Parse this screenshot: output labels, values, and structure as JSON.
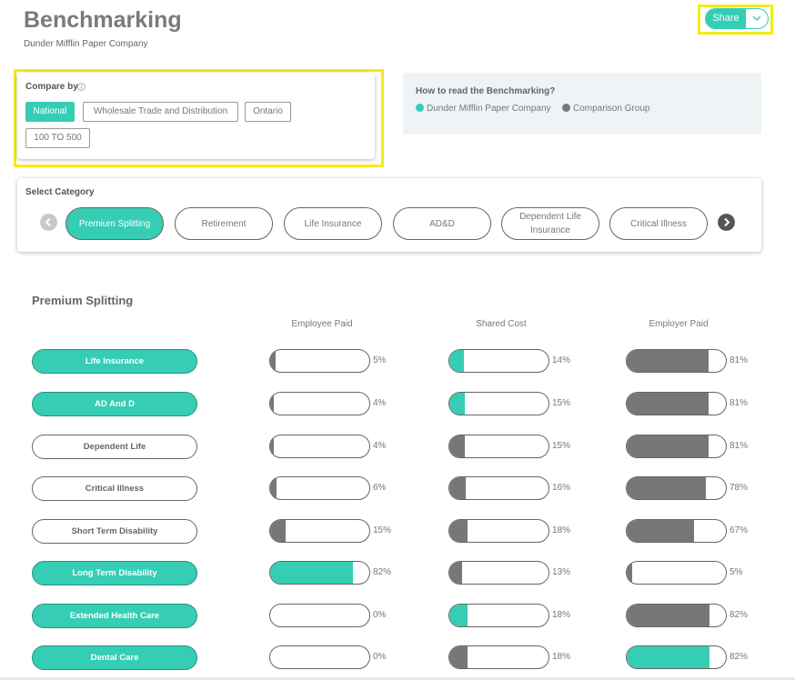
{
  "header": {
    "title": "Benchmarking",
    "company": "Dunder Mifflin Paper Company"
  },
  "share": {
    "label": "Share",
    "chevron_icon": "chevron-down-icon"
  },
  "compare": {
    "label": "Compare by",
    "chips": [
      "National",
      "Wholesale Trade and Distribution",
      "Ontario",
      "100 TO 500"
    ],
    "active_chip": "National"
  },
  "howto": {
    "title": "How to read the Benchmarking?",
    "legend": [
      {
        "label": "Dunder Mifflin Paper Company",
        "color": "#36cdb5"
      },
      {
        "label": "Comparison Group",
        "color": "#777777"
      }
    ]
  },
  "category": {
    "label": "Select Category",
    "pills": [
      "Premium Splitting",
      "Retirement",
      "Life Insurance",
      "AD&D",
      "Dependent Life Insurance",
      "Critical Illness"
    ],
    "active_pill": "Premium Splitting"
  },
  "section": {
    "title": "Premium Splitting",
    "columns": [
      "Employee Paid",
      "Shared Cost",
      "Employer Paid"
    ]
  },
  "colors": {
    "teal": "#36cdb5",
    "gray": "#777777",
    "highlight": "#f5ea1a"
  },
  "rows": [
    {
      "name": "Life Insurance",
      "active": true,
      "cells": [
        {
          "label": "5%",
          "value": 5,
          "hl": false
        },
        {
          "label": "14%",
          "value": 14,
          "hl": true
        },
        {
          "label": "81%",
          "value": 81,
          "hl": false
        }
      ]
    },
    {
      "name": "AD And D",
      "active": true,
      "cells": [
        {
          "label": "4%",
          "value": 4,
          "hl": false
        },
        {
          "label": "15%",
          "value": 15,
          "hl": true
        },
        {
          "label": "81%",
          "value": 81,
          "hl": false
        }
      ]
    },
    {
      "name": "Dependent Life",
      "active": false,
      "cells": [
        {
          "label": "4%",
          "value": 4,
          "hl": false
        },
        {
          "label": "15%",
          "value": 15,
          "hl": false
        },
        {
          "label": "81%",
          "value": 81,
          "hl": false
        }
      ]
    },
    {
      "name": "Critical Illness",
      "active": false,
      "cells": [
        {
          "label": "6%",
          "value": 6,
          "hl": false
        },
        {
          "label": "16%",
          "value": 16,
          "hl": false
        },
        {
          "label": "78%",
          "value": 78,
          "hl": false
        }
      ]
    },
    {
      "name": "Short Term Disability",
      "active": false,
      "cells": [
        {
          "label": "15%",
          "value": 15,
          "hl": false
        },
        {
          "label": "18%",
          "value": 18,
          "hl": false
        },
        {
          "label": "67%",
          "value": 67,
          "hl": false
        }
      ]
    },
    {
      "name": "Long Term Disability",
      "active": true,
      "cells": [
        {
          "label": "82%",
          "value": 82,
          "hl": true
        },
        {
          "label": "13%",
          "value": 13,
          "hl": false
        },
        {
          "label": "5%",
          "value": 5,
          "hl": false
        }
      ]
    },
    {
      "name": "Extended Health Care",
      "active": true,
      "cells": [
        {
          "label": "0%",
          "value": 0,
          "hl": false
        },
        {
          "label": "18%",
          "value": 18,
          "hl": true
        },
        {
          "label": "82%",
          "value": 82,
          "hl": false
        }
      ]
    },
    {
      "name": "Dental Care",
      "active": true,
      "cells": [
        {
          "label": "0%",
          "value": 0,
          "hl": false
        },
        {
          "label": "18%",
          "value": 18,
          "hl": false
        },
        {
          "label": "82%",
          "value": 82,
          "hl": true
        }
      ]
    }
  ]
}
